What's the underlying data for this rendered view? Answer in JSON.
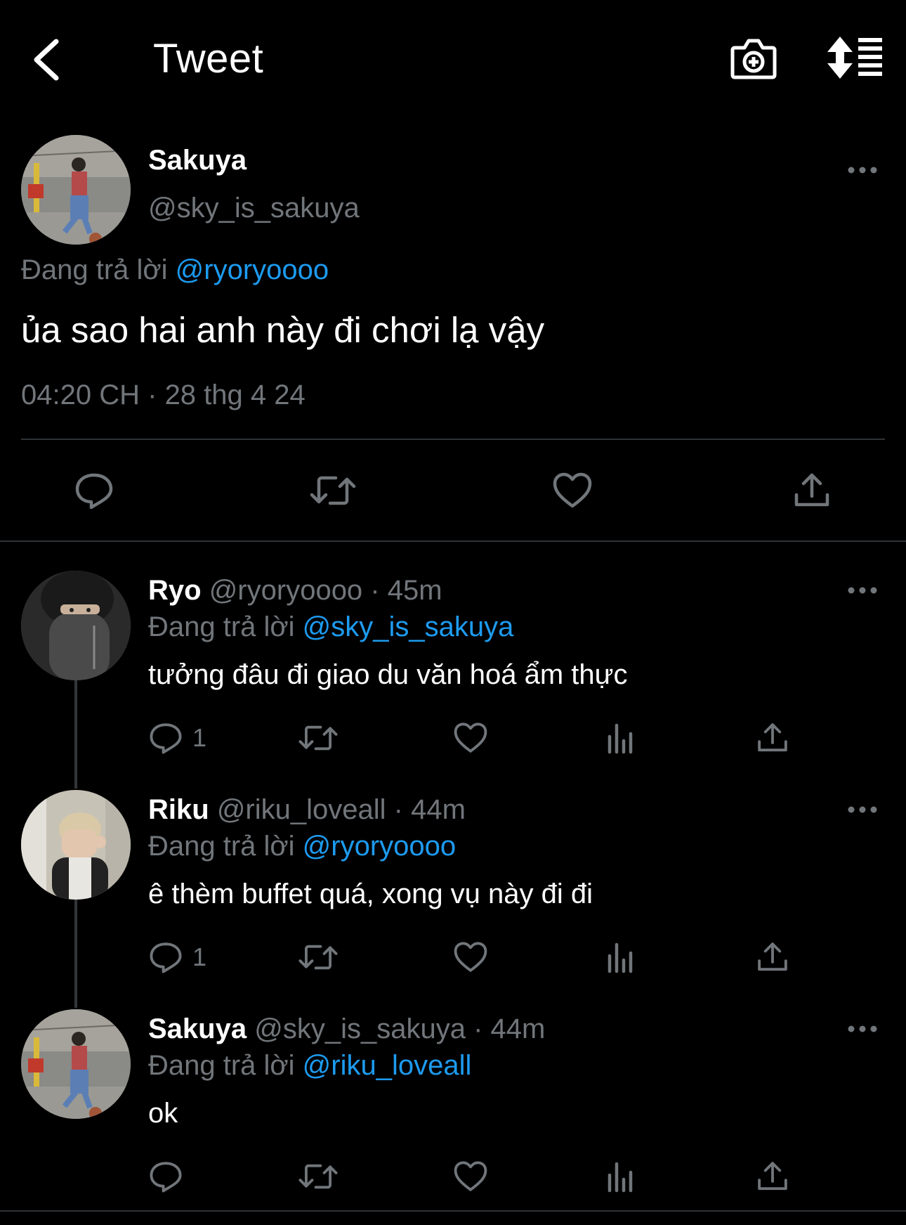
{
  "header": {
    "title": "Tweet",
    "back_icon": "chevron-left-icon",
    "camera_icon": "camera-add-icon",
    "sort_icon": "sort-list-icon"
  },
  "main_tweet": {
    "name": "Sakuya",
    "handle": "@sky_is_sakuya",
    "replying_label": "Đang trả lời",
    "replying_to": "@ryoryoooo",
    "text": "ủa sao hai anh này đi chơi lạ vậy",
    "time": "04:20 CH",
    "date": "28 thg 4 24",
    "separator": "·"
  },
  "replies": [
    {
      "name": "Ryo",
      "handle": "@ryoryoooo",
      "age": "45m",
      "replying_label": "Đang trả lời",
      "replying_to": "@sky_is_sakuya",
      "text": "tưởng đâu đi giao du văn hoá ẩm thực",
      "reply_count": "1"
    },
    {
      "name": "Riku",
      "handle": "@riku_loveall",
      "age": "44m",
      "replying_label": "Đang trả lời",
      "replying_to": "@ryoryoooo",
      "text": "ê thèm buffet quá, xong vụ này đi đi",
      "reply_count": "1"
    },
    {
      "name": "Sakuya",
      "handle": "@sky_is_sakuya",
      "age": "44m",
      "replying_label": "Đang trả lời",
      "replying_to": "@riku_loveall",
      "text": "ok",
      "reply_count": ""
    }
  ],
  "colors": {
    "background": "#000000",
    "text": "#ffffff",
    "secondary": "#71767b",
    "link": "#1d9bf0",
    "divider": "#2f3336"
  }
}
